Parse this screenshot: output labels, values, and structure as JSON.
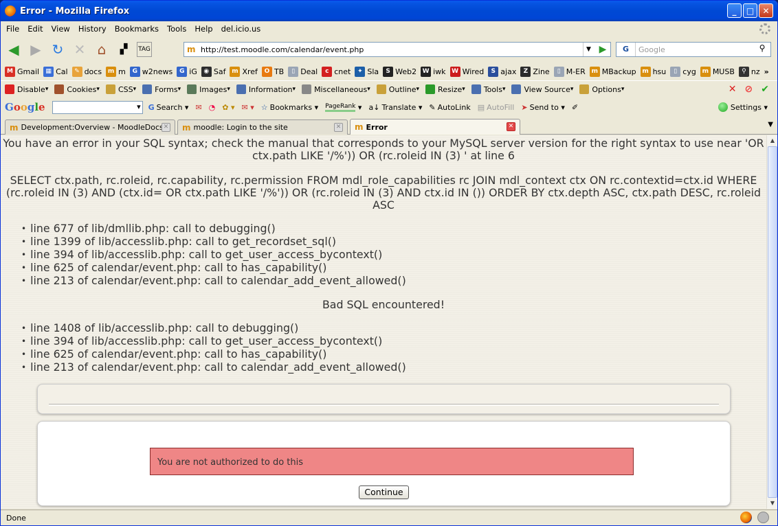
{
  "window": {
    "title": "Error - Mozilla Firefox",
    "min": "_",
    "max": "□",
    "close": "✕"
  },
  "menu": [
    "File",
    "Edit",
    "View",
    "History",
    "Bookmarks",
    "Tools",
    "Help",
    "del.icio.us"
  ],
  "nav": {
    "url": "http://test.moodle.com/calendar/event.php",
    "search_placeholder": "Google",
    "search_engine": "G"
  },
  "bookmarks": [
    {
      "label": "Gmail",
      "color": "#d93025",
      "glyph": "M"
    },
    {
      "label": "Cal",
      "color": "#3a6fd8",
      "glyph": "▦"
    },
    {
      "label": "docs",
      "color": "#e8a33a",
      "glyph": "✎"
    },
    {
      "label": "m",
      "color": "#d98f0e",
      "glyph": "m"
    },
    {
      "label": "w2news",
      "color": "#3366cc",
      "glyph": "G"
    },
    {
      "label": "iG",
      "color": "#3366cc",
      "glyph": "G"
    },
    {
      "label": "Saf",
      "color": "#2d2d2d",
      "glyph": "◉"
    },
    {
      "label": "Xref",
      "color": "#d98f0e",
      "glyph": "m"
    },
    {
      "label": "TB",
      "color": "#e87a10",
      "glyph": "O"
    },
    {
      "label": "Deal",
      "color": "#9aa5b5",
      "glyph": "▯"
    },
    {
      "label": "cnet",
      "color": "#d32020",
      "glyph": "c"
    },
    {
      "label": "Sla",
      "color": "#1b5ea8",
      "glyph": "✦"
    },
    {
      "label": "Web2",
      "color": "#222",
      "glyph": "S"
    },
    {
      "label": "iwk",
      "color": "#222",
      "glyph": "W"
    },
    {
      "label": "Wired",
      "color": "#cc1b1b",
      "glyph": "W"
    },
    {
      "label": "ajax",
      "color": "#2a4e9c",
      "glyph": "S"
    },
    {
      "label": "Zine",
      "color": "#2b2b2b",
      "glyph": "Z"
    },
    {
      "label": "M-ER",
      "color": "#9aa5b5",
      "glyph": "▯"
    },
    {
      "label": "MBackup",
      "color": "#d98f0e",
      "glyph": "m"
    },
    {
      "label": "hsu",
      "color": "#d98f0e",
      "glyph": "m"
    },
    {
      "label": "cyg",
      "color": "#9aa5b5",
      "glyph": "▯"
    },
    {
      "label": "MUSB",
      "color": "#d98f0e",
      "glyph": "m"
    },
    {
      "label": "nz",
      "color": "#333",
      "glyph": "⚲"
    }
  ],
  "bookmarks_more": "»",
  "devtools": [
    "Disable",
    "Cookies",
    "CSS",
    "Forms",
    "Images",
    "Information",
    "Miscellaneous",
    "Outline",
    "Resize",
    "Tools",
    "View Source",
    "Options"
  ],
  "google_toolbar": {
    "logo": "Google",
    "search": "Search",
    "bookmarks": "Bookmarks",
    "pagerank": "PageRank",
    "translate": "Translate",
    "autolink": "AutoLink",
    "autofill": "AutoFill",
    "sendto": "Send to",
    "settings": "Settings"
  },
  "tabs": [
    {
      "label": "Development:Overview - MoodleDocs"
    },
    {
      "label": "moodle: Login to the site"
    },
    {
      "label": "Error"
    }
  ],
  "page": {
    "error_msg": "You have an error in your SQL syntax; check the manual that corresponds to your MySQL server version for the right syntax to use near 'OR ctx.path LIKE '/%')) OR (rc.roleid IN (3) ' at line 6",
    "sql": "SELECT ctx.path, rc.roleid, rc.capability, rc.permission FROM mdl_role_capabilities rc JOIN mdl_context ctx ON rc.contextid=ctx.id WHERE (rc.roleid IN (3) AND (ctx.id= OR ctx.path LIKE '/%')) OR (rc.roleid IN (3) AND ctx.id IN ()) ORDER BY ctx.depth ASC, ctx.path DESC, rc.roleid ASC",
    "trace1": [
      "line 677 of lib/dmllib.php: call to debugging()",
      "line 1399 of lib/accesslib.php: call to get_recordset_sql()",
      "line 394 of lib/accesslib.php: call to get_user_access_bycontext()",
      "line 625 of calendar/event.php: call to has_capability()",
      "line 213 of calendar/event.php: call to calendar_add_event_allowed()"
    ],
    "bad_sql": "Bad SQL encountered!",
    "trace2": [
      "line 1408 of lib/accesslib.php: call to debugging()",
      "line 394 of lib/accesslib.php: call to get_user_access_bycontext()",
      "line 625 of calendar/event.php: call to has_capability()",
      "line 213 of calendar/event.php: call to calendar_add_event_allowed()"
    ],
    "notice": "You are not authorized to do this",
    "continue": "Continue"
  },
  "status": {
    "text": "Done"
  }
}
